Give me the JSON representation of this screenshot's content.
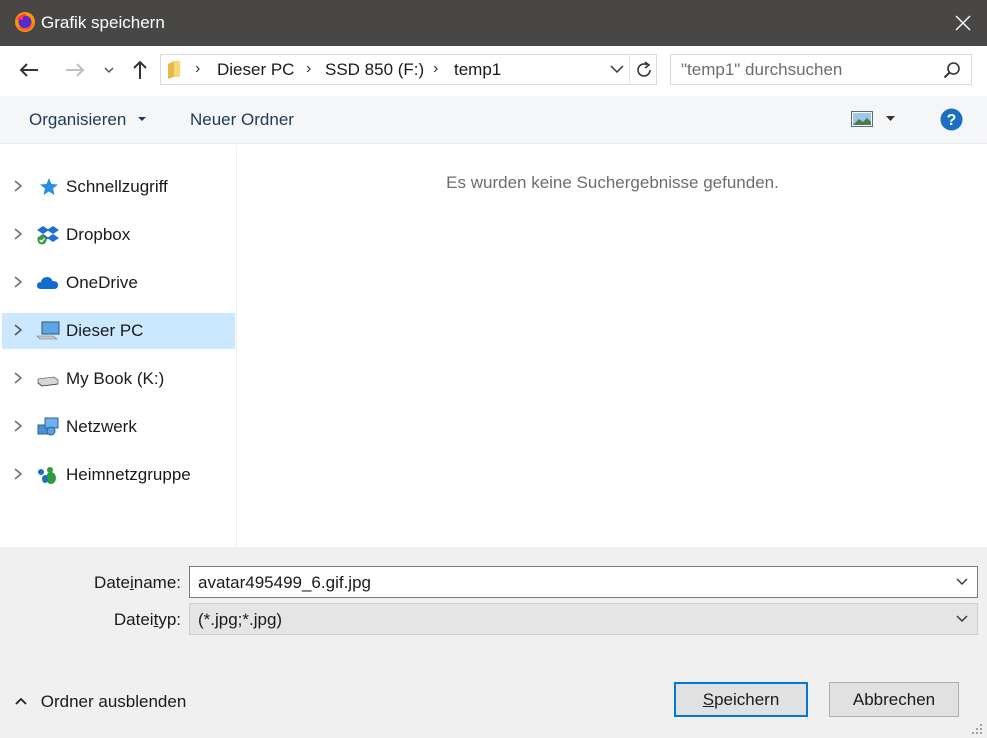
{
  "window": {
    "title": "Grafik speichern"
  },
  "address": {
    "crumbs": [
      "Dieser PC",
      "SSD 850 (F:)",
      "temp1"
    ]
  },
  "search": {
    "placeholder": "\"temp1\" durchsuchen"
  },
  "toolbar": {
    "organize": "Organisieren",
    "new_folder": "Neuer Ordner"
  },
  "sidebar": {
    "items": [
      {
        "label": "Schnellzugriff",
        "icon": "star-icon"
      },
      {
        "label": "Dropbox",
        "icon": "dropbox-icon"
      },
      {
        "label": "OneDrive",
        "icon": "cloud-icon"
      },
      {
        "label": "Dieser PC",
        "icon": "computer-icon",
        "selected": true
      },
      {
        "label": "My Book (K:)",
        "icon": "drive-icon"
      },
      {
        "label": "Netzwerk",
        "icon": "network-icon"
      },
      {
        "label": "Heimnetzgruppe",
        "icon": "homegroup-icon"
      }
    ]
  },
  "content": {
    "empty_message": "Es wurden keine Suchergebnisse gefunden."
  },
  "form": {
    "filename_label_pre": "Date",
    "filename_label_u": "i",
    "filename_label_post": "name:",
    "filename_value": "avatar495499_6.gif.jpg",
    "filetype_label_pre": "Datei",
    "filetype_label_u": "t",
    "filetype_label_post": "yp:",
    "filetype_value": "(*.jpg;*.jpg)"
  },
  "footer": {
    "toggle_folders": "Ordner ausblenden",
    "save_u": "S",
    "save_rest": "peichern",
    "cancel": "Abbrechen"
  },
  "colors": {
    "titlebar": "#494646",
    "selection": "#cce8ff",
    "accent": "#0078d7",
    "help": "#1a6fc4"
  }
}
